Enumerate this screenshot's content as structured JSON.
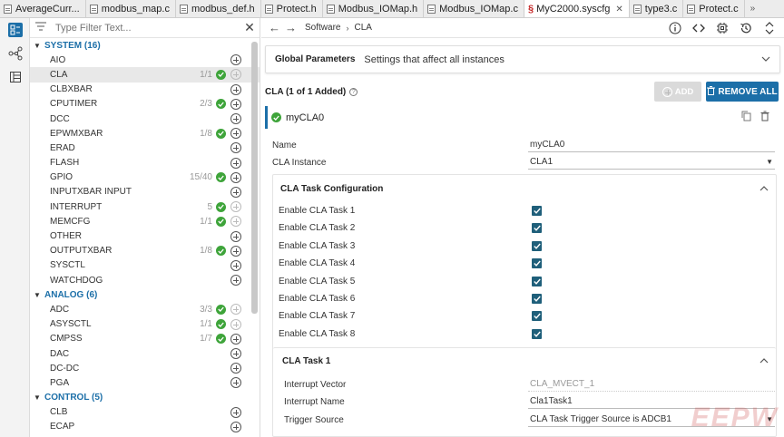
{
  "tabs": [
    {
      "label": "AverageCurr..."
    },
    {
      "label": "modbus_map.c"
    },
    {
      "label": "modbus_def.h"
    },
    {
      "label": "Protect.h"
    },
    {
      "label": "Modbus_IOMap.h"
    },
    {
      "label": "Modbus_IOMap.c"
    },
    {
      "label": "MyC2000.syscfg",
      "active": true
    },
    {
      "label": "type3.c"
    },
    {
      "label": "Protect.c"
    }
  ],
  "tab_overflow": "»",
  "activity": [
    {
      "icon": "list-view-icon",
      "selected": true
    },
    {
      "icon": "hierarchy-view-icon"
    },
    {
      "icon": "device-view-icon"
    }
  ],
  "sidebar": {
    "filter_placeholder": "Type Filter Text...",
    "categories": [
      {
        "label": "SYSTEM (16)",
        "items": [
          {
            "name": "AIO",
            "count": "",
            "ok": false,
            "add_enabled": true
          },
          {
            "name": "CLA",
            "count": "1/1",
            "ok": true,
            "add_enabled": false,
            "selected": true
          },
          {
            "name": "CLBXBAR",
            "count": "",
            "ok": false,
            "add_enabled": true
          },
          {
            "name": "CPUTIMER",
            "count": "2/3",
            "ok": true,
            "add_enabled": true
          },
          {
            "name": "DCC",
            "count": "",
            "ok": false,
            "add_enabled": true
          },
          {
            "name": "EPWMXBAR",
            "count": "1/8",
            "ok": true,
            "add_enabled": true
          },
          {
            "name": "ERAD",
            "count": "",
            "ok": false,
            "add_enabled": true
          },
          {
            "name": "FLASH",
            "count": "",
            "ok": false,
            "add_enabled": true
          },
          {
            "name": "GPIO",
            "count": "15/40",
            "ok": true,
            "add_enabled": true
          },
          {
            "name": "INPUTXBAR INPUT",
            "count": "",
            "ok": false,
            "add_enabled": true
          },
          {
            "name": "INTERRUPT",
            "count": "5",
            "ok": true,
            "add_enabled": false
          },
          {
            "name": "MEMCFG",
            "count": "1/1",
            "ok": true,
            "add_enabled": false
          },
          {
            "name": "OTHER",
            "count": "",
            "ok": false,
            "add_enabled": true
          },
          {
            "name": "OUTPUTXBAR",
            "count": "1/8",
            "ok": true,
            "add_enabled": true
          },
          {
            "name": "SYSCTL",
            "count": "",
            "ok": false,
            "add_enabled": true
          },
          {
            "name": "WATCHDOG",
            "count": "",
            "ok": false,
            "add_enabled": true
          }
        ]
      },
      {
        "label": "ANALOG (6)",
        "items": [
          {
            "name": "ADC",
            "count": "3/3",
            "ok": true,
            "add_enabled": false
          },
          {
            "name": "ASYSCTL",
            "count": "1/1",
            "ok": true,
            "add_enabled": false
          },
          {
            "name": "CMPSS",
            "count": "1/7",
            "ok": true,
            "add_enabled": true
          },
          {
            "name": "DAC",
            "count": "",
            "ok": false,
            "add_enabled": true
          },
          {
            "name": "DC-DC",
            "count": "",
            "ok": false,
            "add_enabled": true
          },
          {
            "name": "PGA",
            "count": "",
            "ok": false,
            "add_enabled": true
          }
        ]
      },
      {
        "label": "CONTROL (5)",
        "items": [
          {
            "name": "CLB",
            "count": "",
            "ok": false,
            "add_enabled": true
          },
          {
            "name": "ECAP",
            "count": "",
            "ok": false,
            "add_enabled": true
          }
        ]
      }
    ]
  },
  "nav": {
    "back": "←",
    "forward": "→",
    "crumbs": [
      "Software",
      "CLA"
    ],
    "crumb_sep": "›"
  },
  "global_params": {
    "title": "Global Parameters",
    "desc": "Settings that affect all instances"
  },
  "cla": {
    "header": "CLA (1 of 1 Added)",
    "add_label": "ADD",
    "remove_label": "REMOVE ALL",
    "instance_name": "myCLA0",
    "fields": [
      {
        "label": "Name",
        "value": "myCLA0",
        "dropdown": false
      },
      {
        "label": "CLA Instance",
        "value": "CLA1",
        "dropdown": true
      }
    ],
    "task_config_title": "CLA Task Configuration",
    "tasks": [
      {
        "label": "Enable CLA Task 1",
        "checked": true
      },
      {
        "label": "Enable CLA Task 2",
        "checked": true
      },
      {
        "label": "Enable CLA Task 3",
        "checked": true
      },
      {
        "label": "Enable CLA Task 4",
        "checked": true
      },
      {
        "label": "Enable CLA Task 5",
        "checked": true
      },
      {
        "label": "Enable CLA Task 6",
        "checked": true
      },
      {
        "label": "Enable CLA Task 7",
        "checked": true
      },
      {
        "label": "Enable CLA Task 8",
        "checked": true
      }
    ],
    "task1": {
      "title": "CLA Task 1",
      "fields": [
        {
          "label": "Interrupt Vector",
          "value": "CLA_MVECT_1",
          "readonly": true
        },
        {
          "label": "Interrupt Name",
          "value": "Cla1Task1",
          "readonly": false
        },
        {
          "label": "Trigger Source",
          "value": "CLA Task Trigger Source is ADCB1",
          "dropdown": true
        }
      ]
    }
  },
  "watermark": "EEPW"
}
